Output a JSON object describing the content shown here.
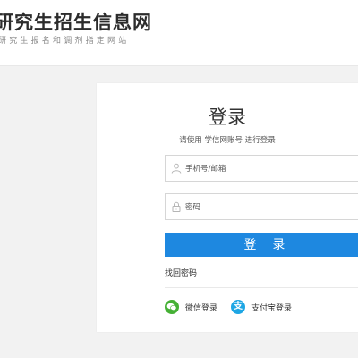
{
  "header": {
    "logo_title": "研究生招生信息网",
    "logo_subtitle": "研究生报名和调剂指定网站"
  },
  "login": {
    "title": "登录",
    "hint": "请使用 学信网账号 进行登录",
    "username_placeholder": "手机号/邮箱",
    "password_placeholder": "密码",
    "submit_label": "登 录",
    "forgot_password": "找回密码",
    "wechat_label": "微信登录",
    "alipay_label": "支付宝登录",
    "alipay_glyph": "支"
  },
  "colors": {
    "primary": "#1e88e0",
    "wechat": "#45b035",
    "alipay": "#1ea6e4"
  }
}
